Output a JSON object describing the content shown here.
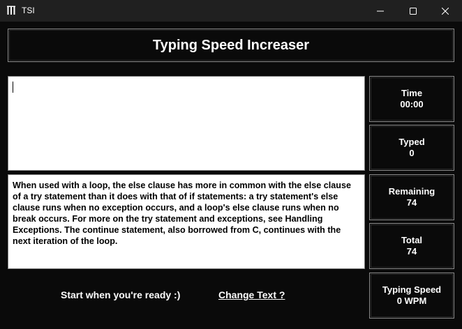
{
  "window": {
    "title": "TSI",
    "controls": {
      "minimize": "minimize-icon",
      "maximize": "maximize-icon",
      "close": "close-icon"
    }
  },
  "header": {
    "title": "Typing Speed Increaser"
  },
  "typing_area": {
    "value": ""
  },
  "source_text": "When used with a loop, the else clause has more in common with the else clause of a try statement than it does with that of if statements: a try statement's else clause runs when no exception occurs, and a loop's else clause runs when no break occurs. For more on the try statement and exceptions, see Handling Exceptions. The continue statement, also borrowed from C, continues with the next iteration of the loop.",
  "stats": {
    "time": {
      "label": "Time",
      "value": "00:00"
    },
    "typed": {
      "label": "Typed",
      "value": "0"
    },
    "remaining": {
      "label": "Remaining",
      "value": "74"
    },
    "total": {
      "label": "Total",
      "value": "74"
    },
    "speed": {
      "label": "Typing Speed",
      "value": "0 WPM"
    }
  },
  "footer": {
    "message": "Start when you're ready :)",
    "change_text_link": "Change Text ?"
  },
  "colors": {
    "background": "#0a0a0a",
    "titlebar": "#202020",
    "border": "#8a8a8a",
    "text": "#ffffff"
  }
}
